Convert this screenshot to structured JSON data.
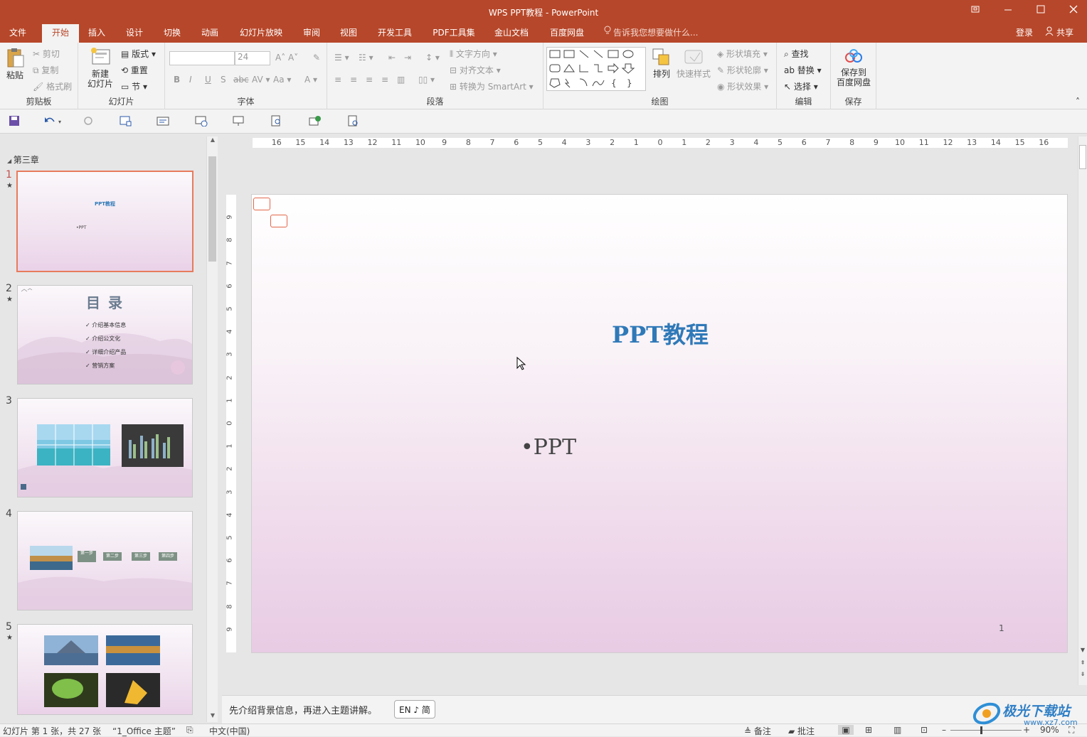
{
  "window": {
    "title": "WPS PPT教程 - PowerPoint",
    "controls": [
      "restore-icon",
      "minimize-icon",
      "maximize-icon",
      "close-icon"
    ]
  },
  "tabs": [
    {
      "label": "文件",
      "active": false
    },
    {
      "label": "开始",
      "active": true
    },
    {
      "label": "插入",
      "active": false
    },
    {
      "label": "设计",
      "active": false
    },
    {
      "label": "切换",
      "active": false
    },
    {
      "label": "动画",
      "active": false
    },
    {
      "label": "幻灯片放映",
      "active": false
    },
    {
      "label": "审阅",
      "active": false
    },
    {
      "label": "视图",
      "active": false
    },
    {
      "label": "开发工具",
      "active": false
    },
    {
      "label": "PDF工具集",
      "active": false
    },
    {
      "label": "金山文档",
      "active": false
    },
    {
      "label": "百度网盘",
      "active": false
    }
  ],
  "tellme": "告诉我您想要做什么...",
  "account": {
    "login": "登录",
    "share": "共享"
  },
  "ribbon": {
    "clipboard": {
      "group": "剪贴板",
      "paste": "粘贴",
      "cut": "剪切",
      "copy": "复制",
      "format_painter": "格式刷"
    },
    "slides": {
      "group": "幻灯片",
      "new_slide_1": "新建",
      "new_slide_2": "幻灯片",
      "layout": "版式",
      "reset": "重置",
      "section": "节"
    },
    "font": {
      "group": "字体",
      "font_name": "",
      "font_size": "24"
    },
    "paragraph": {
      "group": "段落",
      "text_direction": "文字方向",
      "align_text": "对齐文本",
      "smartart": "转换为 SmartArt"
    },
    "drawing": {
      "group": "绘图",
      "arrange": "排列",
      "quick_styles": "快速样式",
      "shape_fill": "形状填充",
      "shape_outline": "形状轮廓",
      "shape_effects": "形状效果"
    },
    "editing": {
      "group": "编辑",
      "find": "查找",
      "replace": "替换",
      "select": "选择"
    },
    "save": {
      "group": "保存",
      "save_to_1": "保存到",
      "save_to_2": "百度网盘"
    }
  },
  "thumbs": {
    "section": "第三章",
    "items": [
      {
        "num": "1",
        "star": true,
        "selected": true,
        "title": "PPT教程",
        "bullet": "•PPT"
      },
      {
        "num": "2",
        "star": true,
        "selected": false,
        "title": "目 录",
        "toc": [
          "介绍基本信息",
          "介绍公文化",
          "详细介绍产品",
          "营销方案"
        ]
      },
      {
        "num": "3",
        "star": false,
        "selected": false
      },
      {
        "num": "4",
        "star": false,
        "selected": false,
        "steps": [
          "第一步",
          "第二步",
          "第三步",
          "第四步"
        ]
      },
      {
        "num": "5",
        "star": true,
        "selected": false
      }
    ]
  },
  "ruler": {
    "h_labels": [
      "16",
      "15",
      "14",
      "13",
      "12",
      "11",
      "10",
      "9",
      "8",
      "7",
      "6",
      "5",
      "4",
      "3",
      "2",
      "1",
      "0",
      "1",
      "2",
      "3",
      "4",
      "5",
      "6",
      "7",
      "8",
      "9",
      "10",
      "11",
      "12",
      "13",
      "14",
      "15",
      "16"
    ],
    "v_labels": [
      "9",
      "8",
      "7",
      "6",
      "5",
      "4",
      "3",
      "2",
      "1",
      "0",
      "1",
      "2",
      "3",
      "4",
      "5",
      "6",
      "7",
      "8",
      "9"
    ]
  },
  "slide": {
    "title": "PPT教程",
    "bullet": "•PPT",
    "page_number": "1"
  },
  "notes": {
    "text": "先介绍背景信息，再进入主题讲解。",
    "ime": "EN ♪ 简"
  },
  "status": {
    "slide_info": "幻灯片 第 1 张，共 27 张",
    "theme": "“1_Office 主题”",
    "language": "中文(中国)",
    "notes": "备注",
    "comments": "批注",
    "zoom": "90%"
  },
  "watermark": "极光下载站",
  "colors": {
    "accent": "#b7472a",
    "title_blue": "#2f79b8",
    "selection": "#e77b5c"
  }
}
